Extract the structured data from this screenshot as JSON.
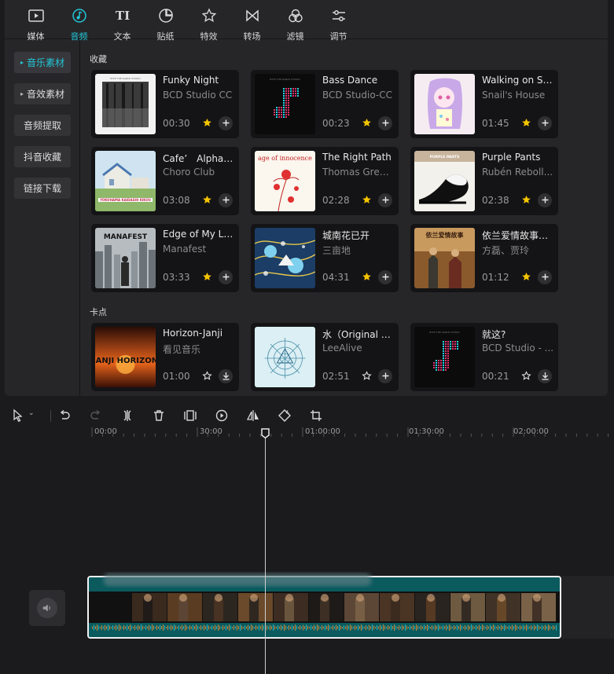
{
  "tabs": [
    {
      "label": "媒体",
      "icon": "media-icon"
    },
    {
      "label": "音频",
      "icon": "music-note-icon",
      "active": true
    },
    {
      "label": "文本",
      "icon": "text-icon"
    },
    {
      "label": "贴纸",
      "icon": "sticker-icon"
    },
    {
      "label": "特效",
      "icon": "effects-star-icon"
    },
    {
      "label": "转场",
      "icon": "transition-icon"
    },
    {
      "label": "滤镜",
      "icon": "filter-icon"
    },
    {
      "label": "调节",
      "icon": "adjust-sliders-icon"
    }
  ],
  "sidebar": {
    "items": [
      {
        "label": "音乐素材",
        "has_arrow": true,
        "active": true
      },
      {
        "label": "音效素材",
        "has_arrow": true
      },
      {
        "label": "音频提取"
      },
      {
        "label": "抖音收藏"
      },
      {
        "label": "链接下载"
      }
    ]
  },
  "sections": {
    "favorites_title": "收藏",
    "beats_title": "卡点"
  },
  "favorites": [
    {
      "title": "Funky Night",
      "artist": "BCD Studio CC",
      "duration": "00:30",
      "action1": "star-filled-icon",
      "action2": "plus-icon",
      "cover_text": "BYTE THE DANCE STUDIO"
    },
    {
      "title": "Bass Dance",
      "artist": "BCD Studio-CC",
      "duration": "00:23",
      "action1": "star-filled-icon",
      "action2": "plus-icon",
      "cover_text": "BYTE THE DANCE STUDIO"
    },
    {
      "title": "Walking on Sn...",
      "artist": "Snail's House",
      "duration": "01:45",
      "action1": "star-filled-icon",
      "action2": "plus-icon"
    },
    {
      "title": "Cafe’　Alpha(...",
      "artist": "Choro Club",
      "duration": "03:08",
      "action1": "star-filled-icon",
      "action2": "plus-icon",
      "cover_text": "YOKOHAMA KAIDASHI KIKOU"
    },
    {
      "title": "The Right Path",
      "artist": "Thomas Green...",
      "duration": "02:28",
      "action1": "star-filled-icon",
      "action2": "plus-icon",
      "cover_text": "age of innocence"
    },
    {
      "title": "Purple Pants",
      "artist": "Rubén Reboll...",
      "duration": "02:38",
      "action1": "star-filled-icon",
      "action2": "plus-icon",
      "cover_text": "PURPLE PANTS"
    },
    {
      "title": "Edge of My Life",
      "artist": "Manafest",
      "duration": "03:33",
      "action1": "star-filled-icon",
      "action2": "plus-icon",
      "cover_text": "MANAFEST"
    },
    {
      "title": "城南花已开",
      "artist": "三亩地",
      "duration": "04:31",
      "action1": "star-filled-icon",
      "action2": "plus-icon"
    },
    {
      "title": "依兰爱情故事（...",
      "artist": "方磊、贾玲",
      "duration": "01:12",
      "action1": "star-filled-icon",
      "action2": "plus-icon",
      "cover_text": "依兰爱情故事"
    }
  ],
  "beats": [
    {
      "title": "Horizon-Janji",
      "artist": "看见音乐",
      "duration": "01:00",
      "action1": "star-outline-icon",
      "action2": "download-icon",
      "cover_text": "JANJI HORIZON"
    },
    {
      "title": "水（Original M...",
      "artist": "LeeAlive",
      "duration": "02:51",
      "action1": "star-outline-icon",
      "action2": "plus-icon"
    },
    {
      "title": "就这?",
      "artist": "BCD Studio - ...",
      "duration": "00:21",
      "action1": "star-outline-icon",
      "action2": "download-icon",
      "cover_text": "BYTE THE DANCE STUDIO"
    }
  ],
  "toolbar": {
    "icons": [
      "select-cursor-icon",
      "undo-icon",
      "redo-icon",
      "split-icon",
      "delete-icon",
      "freeze-frame-icon",
      "reverse-play-icon",
      "mirror-icon",
      "rotate-icon",
      "crop-icon"
    ]
  },
  "ruler": {
    "labels": [
      "00:00",
      "30:00",
      "01:00:00",
      "01:30:00",
      "02:00:00"
    ]
  },
  "colors": {
    "accent": "#22c8d8",
    "star": "#f5c400",
    "clip_border": "#f2f2f2",
    "clip_fill": "#0a5a5e"
  }
}
